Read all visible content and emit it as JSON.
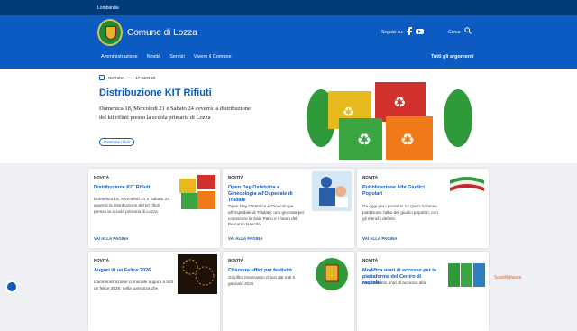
{
  "topbar": {
    "region": "Lombardia"
  },
  "header": {
    "site_title": "Comune di Lozza",
    "social_label": "Seguici su:",
    "search_label": "Cerca"
  },
  "nav": {
    "items": [
      "Amministrazione",
      "Novità",
      "Servizi",
      "Vivere il Comune"
    ],
    "right": "Tutti gli argomenti"
  },
  "hero": {
    "kicker": "NOTIZIA",
    "date": "17 GEN 26",
    "title": "Distribuzione KIT Rifiuti",
    "text": "Domenica 18, Mercoledì 21 e Sabato 24 avverrà la distribuzione del kit rifiuti presso la scuola primaria di Lozza",
    "tag": "Gestione rifiuti"
  },
  "cards": [
    {
      "kicker": "NOVITÀ",
      "title": "Distribuzione KIT Rifiuti",
      "text": "Domenica 18, Mercoledì 21 e Sabato 24 avverrà la distribuzione del kit rifiuti presso la scuola primaria di Lozza",
      "link": "VAI ALLA PAGINA"
    },
    {
      "kicker": "NOVITÀ",
      "title": "Open Day Ostetricia e Ginecologia all'Ospedale di Tradate",
      "text": "Open Day Ostetricia e Ginecologia all'Ospedale di Tradate: una giornata per conoscere la Sala Parto e il team del Percorso Nascita",
      "link": "VAI ALLA PAGINA"
    },
    {
      "kicker": "NOVITÀ",
      "title": "Pubblicazione Albi Giudici Popolari",
      "text": "Da oggi per i prossimi 14 giorni saranno pubblicato l'albo dei giudici popolari, con gli elenchi definiti",
      "link": "VAI ALLA PAGINA"
    },
    {
      "kicker": "NOVITÀ",
      "title": "Auguri di un Felice 2026",
      "text": "L'amministrazione comunale augura a tutti un felice 2026, nella speranza che",
      "link": ""
    },
    {
      "kicker": "NOVITÀ",
      "title": "Chiusura uffici per festività",
      "text": "Gli uffici rimarranno chiusi dal 2 al 5 gennaio 2026",
      "link": ""
    },
    {
      "kicker": "NOVITÀ",
      "title": "Modifica orari di accesso per la piattaforma del Centro di raccolta",
      "text": "Ampliamento orari di accesso alla",
      "link": ""
    }
  ],
  "badge": "ScanMalware",
  "colors": {
    "primary": "#0b5bc2",
    "topbar": "#003a78"
  }
}
